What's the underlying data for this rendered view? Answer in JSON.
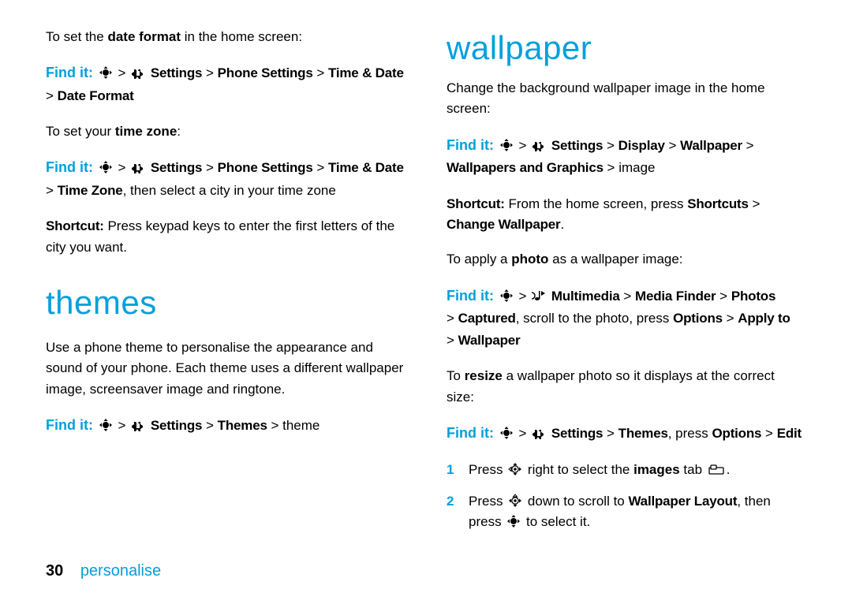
{
  "left": {
    "p1_pre": "To set the ",
    "p1_bold": "date format",
    "p1_post": " in the home screen:",
    "find1_label": "Find it:",
    "find1_path_a": "Settings",
    "find1_path_b": "Phone Settings",
    "find1_path_c": "Time & Date",
    "find1_path_d": "Date Format",
    "p2_pre": "To set your ",
    "p2_bold": "time zone",
    "p2_post": ":",
    "find2_label": "Find it:",
    "find2_path_a": "Settings",
    "find2_path_b": "Phone Settings",
    "find2_path_c": "Time & Date",
    "find2_path_d": "Time Zone",
    "find2_tail": ", then select a city in your time zone",
    "shortcut_label": "Shortcut:",
    "shortcut_text": " Press keypad keys to enter the first letters of the city you want.",
    "themes_title": "themes",
    "themes_p_a": "Use a phone ",
    "themes_p_b": "theme",
    "themes_p_c": " to personalise the appearance and sound of your phone. Each theme uses a different wallpaper image, screensaver image and ringtone.",
    "find3_label": "Find it:",
    "find3_path_a": "Settings",
    "find3_path_b": "Themes",
    "find3_tail": "theme"
  },
  "right": {
    "wall_title": "wallpaper",
    "p1_a": "Change the background ",
    "p1_b": "wallpaper",
    "p1_c": " image in the home screen:",
    "find1_label": "Find it:",
    "find1_path_a": "Settings",
    "find1_path_b": "Display",
    "find1_path_c": "Wallpaper",
    "find1_path_d": "Wallpapers and Graphics",
    "find1_tail": "image",
    "short_label": "Shortcut:",
    "short_a": " From the home screen, press ",
    "short_b": "Shortcuts",
    "short_c": "Change Wallpaper",
    "short_d": ".",
    "p2_a": "To apply a ",
    "p2_b": "photo",
    "p2_c": " as a wallpaper image:",
    "find2_label": "Find it:",
    "find2_path_a": "Multimedia",
    "find2_path_b": "Media Finder",
    "find2_path_c": "Photos",
    "find2_path_d": "Captured",
    "find2_mid": ", scroll to the photo, press ",
    "find2_path_e": "Options",
    "find2_path_f": "Apply to",
    "find2_path_g": "Wallpaper",
    "p3_a": "To ",
    "p3_b": "resize",
    "p3_c": " a wallpaper photo so it displays at the correct size:",
    "find3_label": "Find it:",
    "find3_path_a": "Settings",
    "find3_path_b": "Themes",
    "find3_mid": ", press ",
    "find3_path_c": "Options",
    "find3_path_d": "Edit",
    "step1_num": "1",
    "step1_a": "Press ",
    "step1_b": " right to select the ",
    "step1_c": "images",
    "step1_d": " tab ",
    "step1_e": ".",
    "step2_num": "2",
    "step2_a": "Press ",
    "step2_b": " down to scroll to ",
    "step2_c": "Wallpaper Layout",
    "step2_d": ", then press ",
    "step2_e": " to select it."
  },
  "footer": {
    "page": "30",
    "chapter": "personalise"
  }
}
